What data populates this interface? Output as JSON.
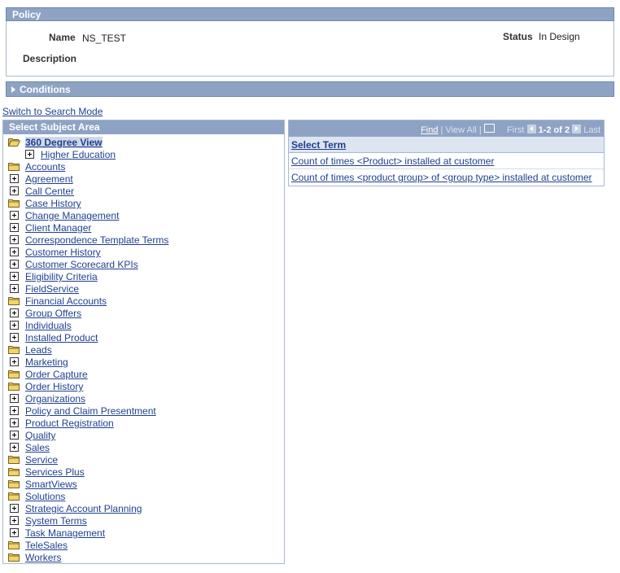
{
  "policy": {
    "header": "Policy",
    "name_label": "Name",
    "name_value": "NS_TEST",
    "status_label": "Status",
    "status_value": "In Design",
    "description_label": "Description"
  },
  "conditions": {
    "header": "Conditions"
  },
  "switch_mode_link": "Switch to Search Mode",
  "subject_area": {
    "header": "Select Subject Area",
    "root": {
      "label": "360 Degree View",
      "icon": "open-folder-icon"
    },
    "items": [
      {
        "label": "Higher Education",
        "icon": "plus-box-icon"
      },
      {
        "label": "Accounts",
        "icon": "folder-icon"
      },
      {
        "label": "Agreement",
        "icon": "plus-box-icon"
      },
      {
        "label": "Call Center",
        "icon": "plus-box-icon"
      },
      {
        "label": "Case History",
        "icon": "folder-icon"
      },
      {
        "label": "Change Management",
        "icon": "plus-box-icon"
      },
      {
        "label": "Client Manager",
        "icon": "plus-box-icon"
      },
      {
        "label": "Correspondence Template Terms",
        "icon": "plus-box-icon"
      },
      {
        "label": "Customer History",
        "icon": "plus-box-icon"
      },
      {
        "label": "Customer Scorecard KPIs",
        "icon": "plus-box-icon"
      },
      {
        "label": "Eligibility Criteria",
        "icon": "plus-box-icon"
      },
      {
        "label": "FieldService",
        "icon": "plus-box-icon"
      },
      {
        "label": "Financial Accounts",
        "icon": "folder-icon"
      },
      {
        "label": "Group Offers",
        "icon": "plus-box-icon"
      },
      {
        "label": "Individuals",
        "icon": "plus-box-icon"
      },
      {
        "label": "Installed Product",
        "icon": "plus-box-icon"
      },
      {
        "label": "Leads",
        "icon": "folder-icon"
      },
      {
        "label": "Marketing",
        "icon": "plus-box-icon"
      },
      {
        "label": "Order Capture",
        "icon": "folder-icon"
      },
      {
        "label": "Order History",
        "icon": "folder-icon"
      },
      {
        "label": "Organizations",
        "icon": "plus-box-icon"
      },
      {
        "label": "Policy and Claim Presentment",
        "icon": "plus-box-icon"
      },
      {
        "label": "Product Registration",
        "icon": "plus-box-icon"
      },
      {
        "label": "Quality",
        "icon": "plus-box-icon"
      },
      {
        "label": "Sales",
        "icon": "plus-box-icon"
      },
      {
        "label": "Service",
        "icon": "folder-icon"
      },
      {
        "label": "Services Plus",
        "icon": "folder-icon"
      },
      {
        "label": "SmartViews",
        "icon": "folder-icon"
      },
      {
        "label": "Solutions",
        "icon": "folder-icon"
      },
      {
        "label": "Strategic Account Planning",
        "icon": "plus-box-icon"
      },
      {
        "label": "System Terms",
        "icon": "plus-box-icon"
      },
      {
        "label": "Task Management",
        "icon": "plus-box-icon"
      },
      {
        "label": "TeleSales",
        "icon": "folder-icon"
      },
      {
        "label": "Workers",
        "icon": "folder-icon"
      }
    ]
  },
  "term_grid": {
    "find": "Find",
    "separator": "|",
    "view_all": "View All",
    "first": "First",
    "count": "1-2 of 2",
    "last": "Last",
    "column_header": "Select Term",
    "rows": [
      "Count of times <Product> installed at customer",
      "Count of times <product group> of <group type> installed at customer"
    ]
  },
  "colors": {
    "header_bar": "#8ea3c4",
    "link": "#1f3f8f",
    "border": "#a9b8d0",
    "folder": "#f3d36b"
  }
}
